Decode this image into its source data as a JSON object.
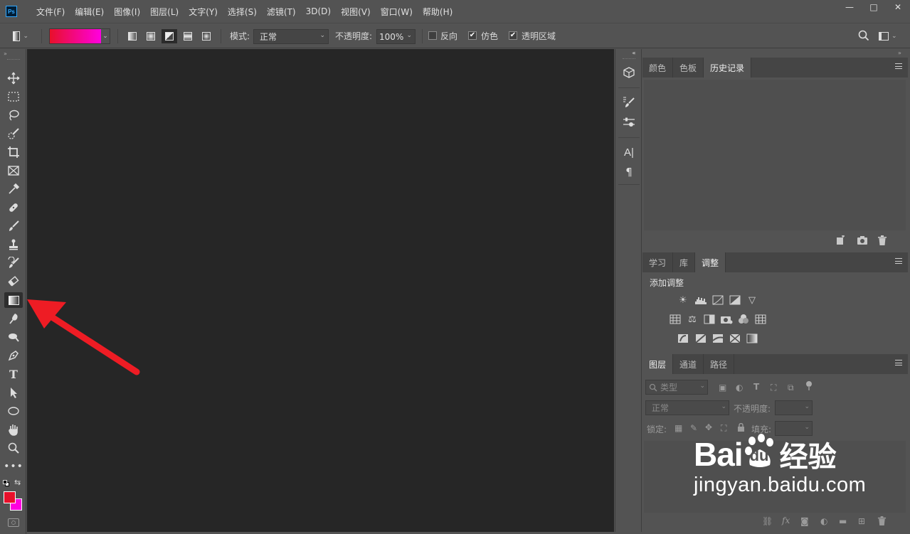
{
  "app": {
    "logo": "Ps"
  },
  "menu": [
    "文件(F)",
    "编辑(E)",
    "图像(I)",
    "图层(L)",
    "文字(Y)",
    "选择(S)",
    "滤镜(T)",
    "3D(D)",
    "视图(V)",
    "窗口(W)",
    "帮助(H)"
  ],
  "window_controls": {
    "minimize": "—",
    "maximize": "□",
    "close": "✕"
  },
  "options": {
    "mode_label": "模式:",
    "mode_value": "正常",
    "opacity_label": "不透明度:",
    "opacity_value": "100%",
    "reverse_label": "反向",
    "dither_label": "仿色",
    "transparency_label": "透明区域",
    "reverse_checked": false,
    "dither_checked": true,
    "transparency_checked": true,
    "gradient_colors": [
      "#e8102a",
      "#ff00e0"
    ]
  },
  "colors": {
    "foreground": "#e8102a",
    "background": "#ff00e0",
    "canvas": "#262626",
    "accent_arrow": "#ee1c24"
  },
  "history_panel": {
    "tabs": [
      "颜色",
      "色板",
      "历史记录"
    ],
    "active_tab": "历史记录"
  },
  "adjust_panel": {
    "tabs": [
      "学习",
      "库",
      "调整"
    ],
    "active_tab": "调整",
    "heading": "添加调整"
  },
  "layers_panel": {
    "tabs": [
      "图层",
      "通道",
      "路径"
    ],
    "active_tab": "图层",
    "filter_placeholder": "类型",
    "blend_mode": "正常",
    "opacity_label": "不透明度:",
    "lock_label": "锁定:",
    "fill_label": "填充:"
  },
  "watermark": {
    "brand": "Bai",
    "brand2": "du",
    "suffix": "经验",
    "url": "jingyan.baidu.com"
  }
}
